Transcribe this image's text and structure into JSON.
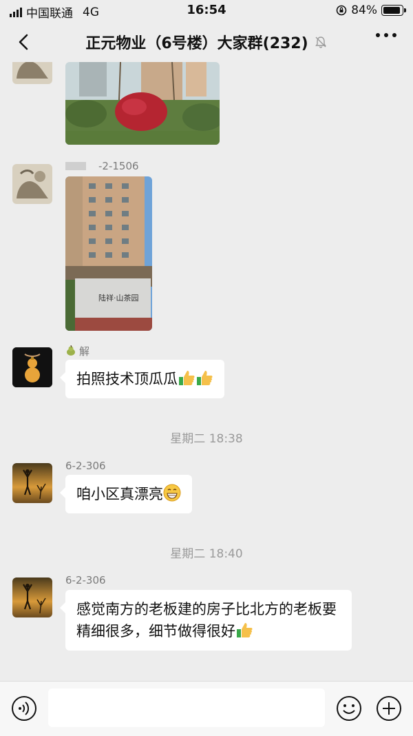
{
  "status_bar": {
    "carrier": "中国联通",
    "network": "4G",
    "time": "16:54",
    "battery": "84%"
  },
  "nav": {
    "title": "正元物业（6号楼）大家群(232)"
  },
  "messages": [
    {
      "sender": "-2-1506"
    },
    {
      "sender": "解",
      "text": "拍照技术顶瓜瓜"
    },
    {
      "sender": "6-2-306",
      "text": "咱小区真漂亮"
    },
    {
      "sender": "6-2-306",
      "text": "感觉南方的老板建的房子比北方的老板要精细很多，细节做得很好"
    }
  ],
  "time_labels": [
    "星期二 18:38",
    "星期二 18:40"
  ],
  "photo_sign": "陆祥·山茶园",
  "colors": {
    "background": "#ededed",
    "bubble": "#ffffff",
    "thumb": "#f5c04a"
  },
  "icons": [
    "back-icon",
    "mute-bell-icon",
    "more-icon",
    "voice-icon",
    "emoji-icon",
    "plus-icon"
  ]
}
